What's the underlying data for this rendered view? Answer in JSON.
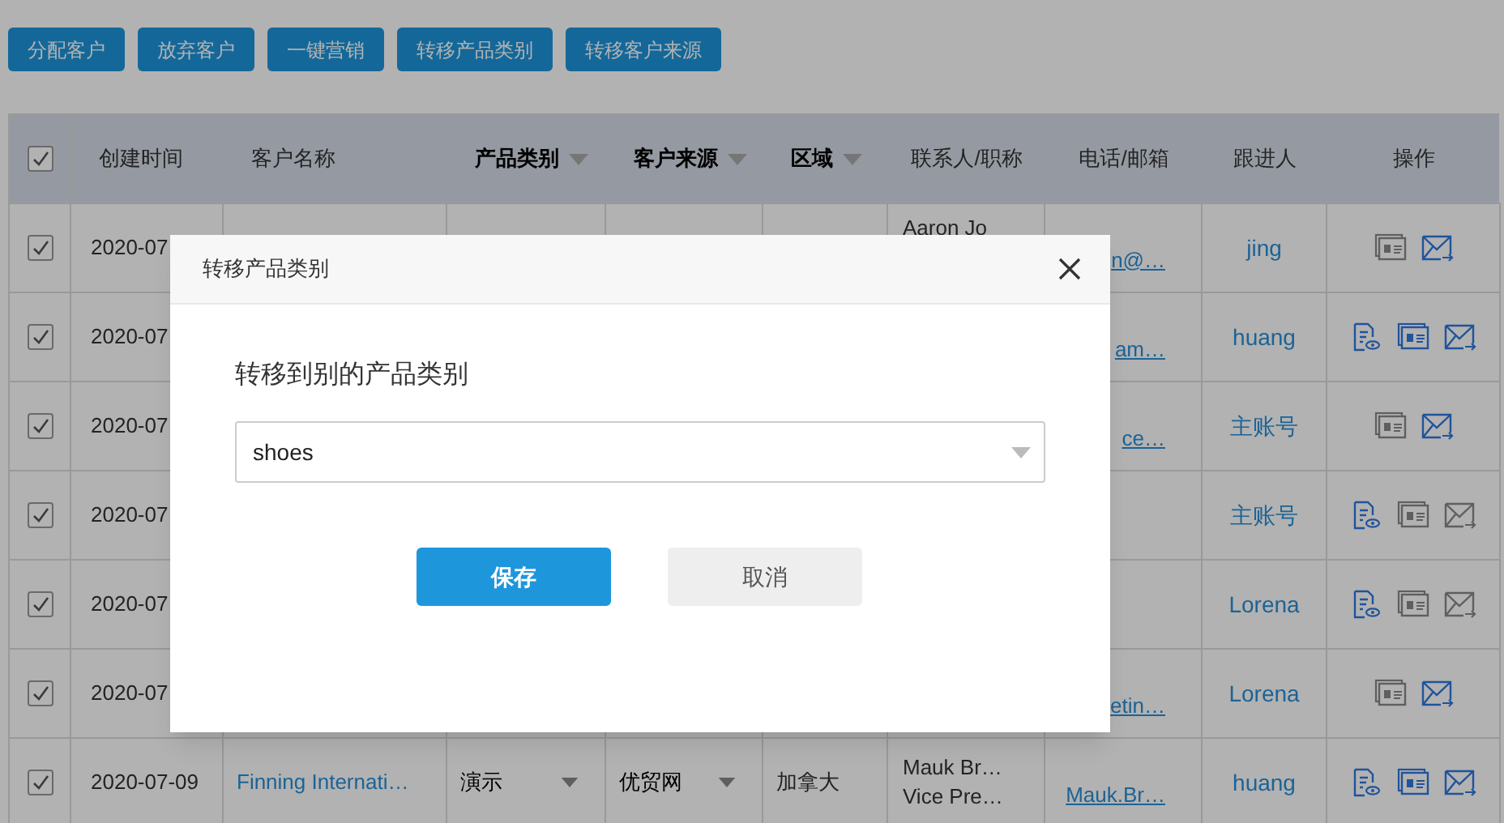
{
  "toolbar": {
    "buttons": [
      "分配客户",
      "放弃客户",
      "一键营销",
      "转移产品类别",
      "转移客户来源"
    ]
  },
  "table": {
    "select_all": {
      "checked": true
    },
    "columns": [
      {
        "label": "创建时间",
        "filter": false
      },
      {
        "label": "客户名称",
        "filter": false
      },
      {
        "label": "产品类别",
        "filter": true
      },
      {
        "label": "客户来源",
        "filter": true
      },
      {
        "label": "区域",
        "filter": true
      },
      {
        "label": "联系人/职称",
        "filter": false
      },
      {
        "label": "电话/邮箱",
        "filter": false
      },
      {
        "label": "跟进人",
        "filter": false
      },
      {
        "label": "操作",
        "filter": false
      }
    ],
    "rows": [
      {
        "checked": true,
        "date": "2020-07",
        "contact": [
          "Aaron Jo"
        ],
        "email": "n@…",
        "follower": "jing",
        "actions": [
          {
            "kind": "card",
            "active": false
          },
          {
            "kind": "mail",
            "active": true
          }
        ]
      },
      {
        "checked": true,
        "date": "2020-07",
        "email": "am…",
        "follower": "huang",
        "actions": [
          {
            "kind": "doc",
            "active": true
          },
          {
            "kind": "card",
            "active": true
          },
          {
            "kind": "mail",
            "active": true
          }
        ]
      },
      {
        "checked": true,
        "date": "2020-07",
        "email": "ce…",
        "follower": "主账号",
        "actions": [
          {
            "kind": "card",
            "active": false
          },
          {
            "kind": "mail",
            "active": true
          }
        ]
      },
      {
        "checked": true,
        "date": "2020-07",
        "follower": "主账号",
        "actions": [
          {
            "kind": "doc",
            "active": true
          },
          {
            "kind": "card",
            "active": false
          },
          {
            "kind": "mail",
            "active": false
          }
        ]
      },
      {
        "checked": true,
        "date": "2020-07",
        "follower": "Lorena",
        "actions": [
          {
            "kind": "doc",
            "active": true
          },
          {
            "kind": "card",
            "active": false
          },
          {
            "kind": "mail",
            "active": false
          }
        ]
      },
      {
        "checked": true,
        "date": "2020-07",
        "email": "etin…",
        "follower": "Lorena",
        "actions": [
          {
            "kind": "card",
            "active": false
          },
          {
            "kind": "mail",
            "active": true
          }
        ]
      },
      {
        "checked": true,
        "date": "2020-07-09",
        "name": "Finning Internati…",
        "category": "演示",
        "source": "优贸网",
        "region": "加拿大",
        "contact": [
          "Mauk Br…",
          "Vice Pre…"
        ],
        "email": "Mauk.Br…",
        "follower": "huang",
        "actions": [
          {
            "kind": "doc",
            "active": true
          },
          {
            "kind": "card",
            "active": true
          },
          {
            "kind": "mail",
            "active": true
          }
        ]
      }
    ]
  },
  "dialog": {
    "title": "转移产品类别",
    "prompt": "转移到别的产品类别",
    "select": {
      "value": "shoes"
    },
    "buttons": [
      {
        "label": "保存",
        "kind": "primary"
      },
      {
        "label": "取消",
        "kind": "secondary"
      }
    ]
  }
}
